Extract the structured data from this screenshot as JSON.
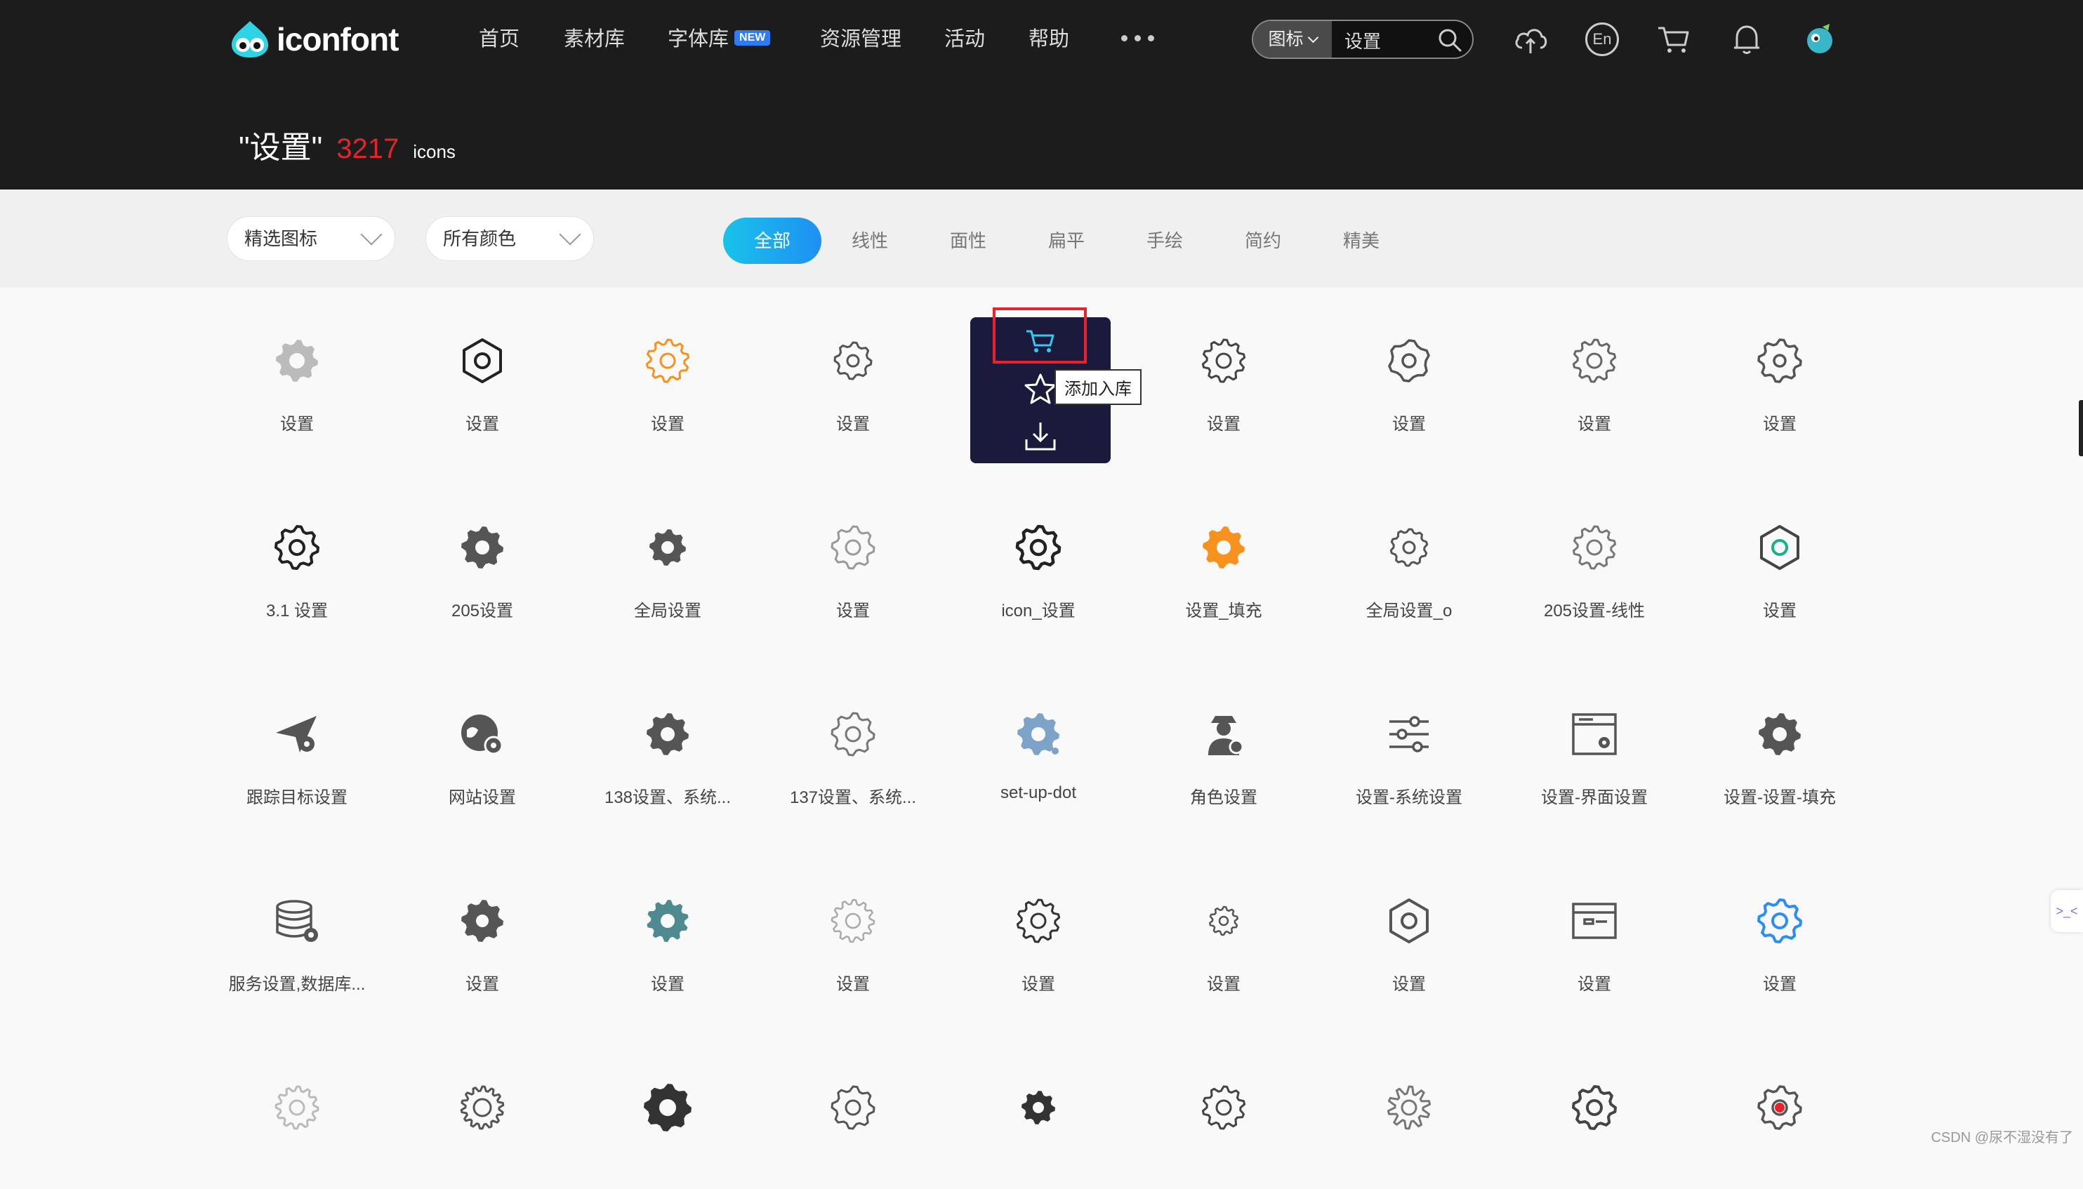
{
  "header": {
    "logo_text": "iconfont",
    "nav": [
      {
        "label": "首页"
      },
      {
        "label": "素材库"
      },
      {
        "label": "字体库",
        "badge": "NEW"
      },
      {
        "label": "资源管理"
      },
      {
        "label": "活动"
      },
      {
        "label": "帮助"
      }
    ],
    "search": {
      "type_label": "图标",
      "value": "设置"
    },
    "icons": [
      "upload-cloud-icon",
      "language-en-icon",
      "cart-icon",
      "bell-icon",
      "user-avatar"
    ],
    "lang_label": "En"
  },
  "result": {
    "query": "\"设置\"",
    "count": "3217",
    "unit": "icons"
  },
  "filters": {
    "dropdowns": [
      "精选图标",
      "所有颜色"
    ],
    "tabs": [
      "全部",
      "线性",
      "面性",
      "扁平",
      "手绘",
      "简约",
      "精美"
    ],
    "active_tab": "全部"
  },
  "icons": {
    "row1": [
      "设置",
      "设置",
      "设置",
      "设置",
      "",
      "设置",
      "设置",
      "设置",
      "设置"
    ],
    "row2": [
      "3.1 设置",
      "205设置",
      "全局设置",
      "设置",
      "icon_设置",
      "设置_填充",
      "全局设置_o",
      "205设置-线性",
      "设置"
    ],
    "row3": [
      "跟踪目标设置",
      "网站设置",
      "138设置、系统...",
      "137设置、系统...",
      "set-up-dot",
      "角色设置",
      "设置-系统设置",
      "设置-界面设置",
      "设置-设置-填充"
    ],
    "row4": [
      "服务设置,数据库...",
      "设置",
      "设置",
      "设置",
      "设置",
      "设置",
      "设置",
      "设置",
      "设置"
    ],
    "row5": [
      "",
      "",
      "",
      "",
      "",
      "",
      "",
      "",
      ""
    ]
  },
  "hover": {
    "tooltip": "添加入库"
  },
  "colors": {
    "accent": "#1e90f4",
    "header_bg": "#1c1c1c",
    "count_red": "#e0262d",
    "orange": "#f7921e",
    "blue": "#2c8df5",
    "teal": "#4e8a8f"
  },
  "widget_label": ">_<",
  "watermark": "CSDN @尿不湿没有了"
}
